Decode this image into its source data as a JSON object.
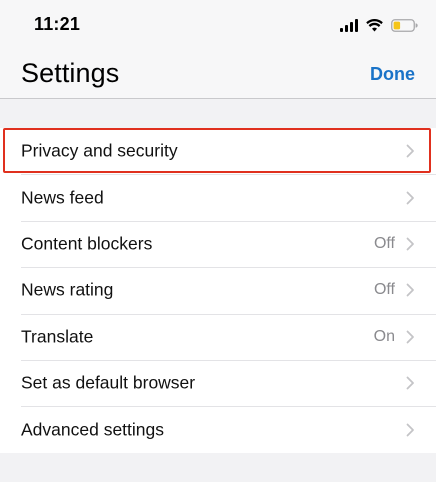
{
  "status_bar": {
    "time": "11:21",
    "icons": [
      "cellular-signal-icon",
      "wifi-icon",
      "battery-low-icon"
    ],
    "battery_color": "#f5c518"
  },
  "header": {
    "title": "Settings",
    "done_label": "Done",
    "accent_color": "#1a73c8"
  },
  "settings": {
    "items": [
      {
        "label": "Privacy and security",
        "value": ""
      },
      {
        "label": "News feed",
        "value": ""
      },
      {
        "label": "Content blockers",
        "value": "Off"
      },
      {
        "label": "News rating",
        "value": "Off"
      },
      {
        "label": "Translate",
        "value": "On"
      },
      {
        "label": "Set as default browser",
        "value": ""
      },
      {
        "label": "Advanced settings",
        "value": ""
      }
    ],
    "chevron_icon": "chevron-right-icon"
  },
  "highlight": {
    "target": "Privacy and security",
    "color": "#e0301e"
  }
}
